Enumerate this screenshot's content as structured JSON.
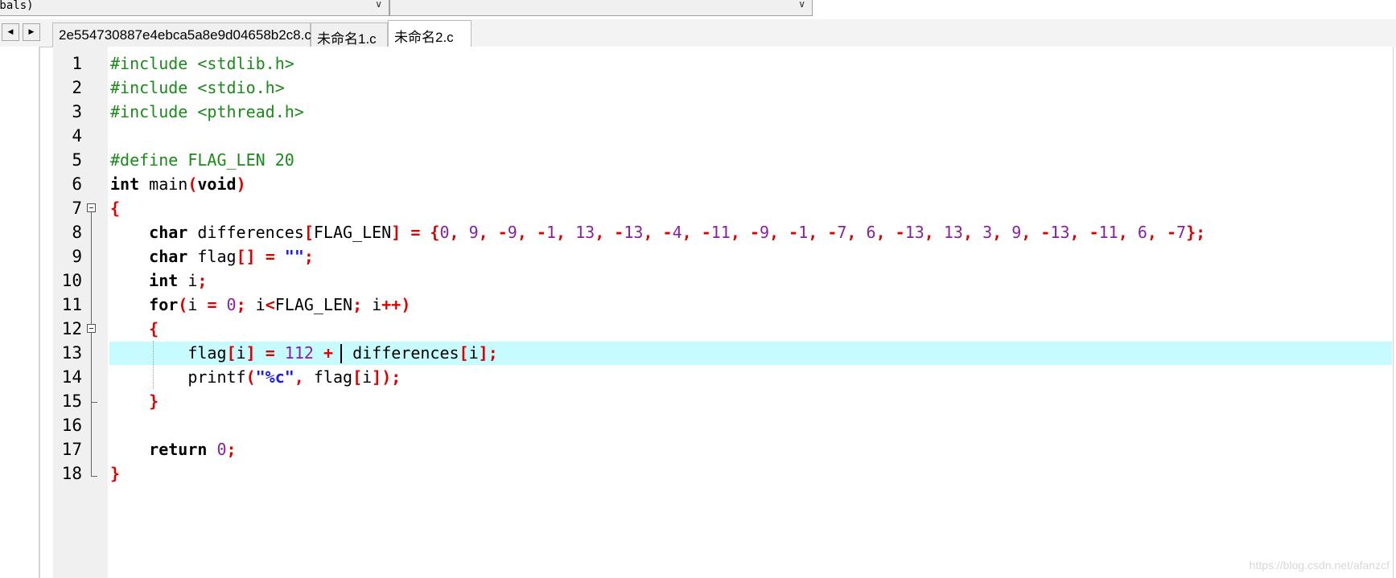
{
  "toolbar": {
    "scope_combo_value": "obals)",
    "symbol_combo_value": ""
  },
  "tabs": [
    {
      "label": "2e554730887e4ebca5a8e9d04658b2c8.c",
      "active": false
    },
    {
      "label": "未命名1.c",
      "active": false
    },
    {
      "label": "未命名2.c",
      "active": true
    }
  ],
  "editor": {
    "current_line": 13,
    "lines": [
      "#include <stdlib.h>",
      "#include <stdio.h>",
      "#include <pthread.h>",
      "",
      "#define FLAG_LEN 20",
      "int main(void)",
      "{",
      "    char differences[FLAG_LEN] = {0, 9, -9, -1, 13, -13, -4, -11, -9, -1, -7, 6, -13, 13, 3, 9, -13, -11, 6, -7};",
      "    char flag[] = \"\";",
      "    int i;",
      "    for(i = 0; i<FLAG_LEN; i++)",
      "    {",
      "        flag[i] = 112 +  differences[i];",
      "        printf(\"%c\", flag[i]);",
      "    }",
      "",
      "    return 0;",
      "}"
    ]
  },
  "watermark": "https://blog.csdn.net/afanzcf",
  "colors": {
    "preprocessor": "#1a8a1a",
    "number": "#8a1fa6",
    "operator": "#e00000",
    "string": "#1a1aff",
    "current_line_highlight": "#c6fbff"
  }
}
